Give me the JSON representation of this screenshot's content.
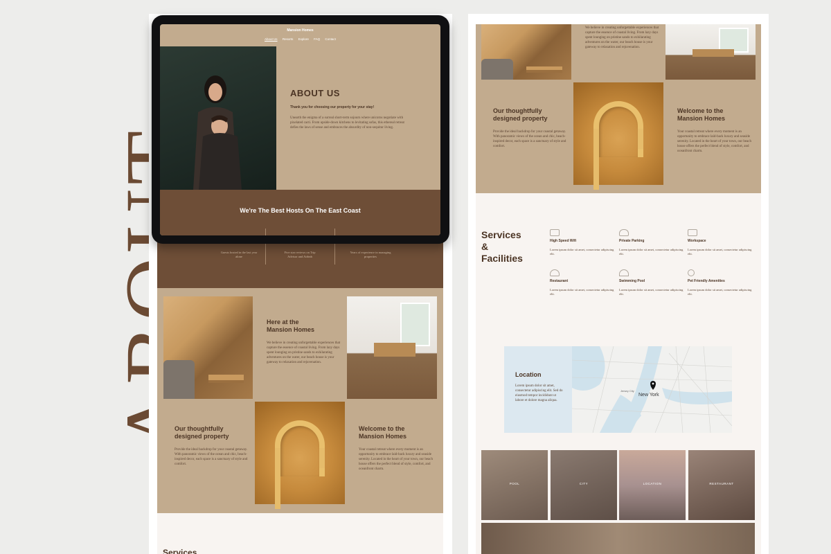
{
  "side_title": "ABOUT",
  "tablet": {
    "brand": "Mansion Homes",
    "nav": [
      "About Us",
      "Resorts",
      "Explore",
      "FAQ",
      "Contact"
    ],
    "about_title": "ABOUT US",
    "about_subtitle": "Thank you for choosing our property for your stay!",
    "about_body": "Unearth the enigma of a surreal short-term sojourn where unicorns negotiate with pixelated cacti. From upside-down kitchens to levitating sofas, this ethereal retreat defies the laws of sense and embraces the absurdity of non-sequitur living.",
    "banner": "We're The Best Hosts On The East Coast"
  },
  "left": {
    "stats": [
      "Guests hosted in the last year alone",
      "Five star reviews on Trip Advisor and Airbnb",
      "Years of experience in managing properties"
    ],
    "here_title": "Here at the Mansion Homes",
    "here_body": "We believe in creating unforgettable experiences that capture the essence of coastal living. From lazy days spent lounging on pristine sands to exhilarating adventures on the water, our beach house is your gateway to relaxation and rejuvenation.",
    "designed_title": "Our thoughtfully designed property",
    "designed_body": "Provide the ideal backdrop for your coastal getaway. With panoramic views of the ocean and chic, beach-inspired decor, each space is a sanctuary of style and comfort.",
    "welcome_title": "Welcome to the Mansion Homes",
    "welcome_body": "Your coastal retreat where every moment is an opportunity to embrace laid-back luxury and seaside serenity. Located in the heart of your town, our beach house offers the perfect blend of style, comfort, and oceanfront charm.",
    "services_peek": "Services"
  },
  "right": {
    "top_body": "We believe in creating unforgettable experiences that capture the essence of coastal living. From lazy days spent lounging on pristine sands to exhilarating adventures on the water, our beach house is your gateway to relaxation and rejuvenation.",
    "designed_title": "Our thoughtfully designed property",
    "designed_body": "Provide the ideal backdrop for your coastal getaway. With panoramic views of the ocean and chic, beach-inspired decor, each space is a sanctuary of style and comfort.",
    "welcome_title": "Welcome to the Mansion Homes",
    "welcome_body": "Your coastal retreat where every moment is an opportunity to embrace laid-back luxury and seaside serenity. Located in the heart of your town, our beach house offers the perfect blend of style, comfort, and oceanfront charm.",
    "services_title_1": "Services",
    "services_title_2": "&",
    "services_title_3": "Facilities",
    "services": [
      {
        "title": "High Speed Wifi",
        "desc": "Lorem ipsum dolor sit amet, consectetur adipiscing elit.",
        "icon": "laptop-icon"
      },
      {
        "title": "Private Parking",
        "desc": "Lorem ipsum dolor sit amet, consectetur adipiscing elit.",
        "icon": "car-icon"
      },
      {
        "title": "Workspace",
        "desc": "Lorem ipsum dolor sit amet, consectetur adipiscing elit.",
        "icon": "desk-icon"
      },
      {
        "title": "Restaurant",
        "desc": "Lorem ipsum dolor sit amet, consectetur adipiscing elit.",
        "icon": "dish-icon"
      },
      {
        "title": "Swimming Pool",
        "desc": "Lorem ipsum dolor sit amet, consectetur adipiscing elit.",
        "icon": "umbrella-icon"
      },
      {
        "title": "Pet Friendly Amenities",
        "desc": "Lorem ipsum dolor sit amet, consectetur adipiscing elit.",
        "icon": "pet-icon"
      }
    ],
    "location_title": "Location",
    "location_body": "Lorem ipsum dolor sit amet, consectetur adipiscing elit. Sed do eiusmod tempor incididunt ut labore et dolore magna aliqua.",
    "map_city": "New York",
    "map_area": "Jersey City",
    "gallery": [
      "POOL",
      "CITY",
      "LOCATION",
      "RESTAURANT"
    ]
  },
  "colors": {
    "tan": "#c2ab8e",
    "brown": "#6e4e37",
    "cream": "#f8f4f1",
    "dark_text": "#4b3424",
    "map_water": "#cfe2ec"
  }
}
